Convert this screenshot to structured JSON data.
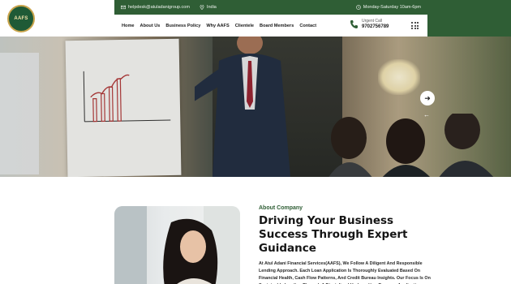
{
  "header": {
    "logo_text": "AAFS",
    "email": "helpdesk@atuladanigroup.com",
    "location": "India",
    "hours": "Monday-Saturday 10am-6pm",
    "nav": [
      "Home",
      "About Us",
      "Business Policy",
      "Why AAFS",
      "Clientele",
      "Board Members",
      "Contact"
    ],
    "call_label": "Urgent Call",
    "call_number": "9702756789",
    "colors": {
      "brand_green": "#2f5e35",
      "logo_gold": "#c9a44c"
    }
  },
  "hero": {
    "next_icon": "arrow-right-icon",
    "prev_icon": "arrow-left-icon"
  },
  "about": {
    "label": "About Company",
    "heading": "Driving Your Business Success Through Expert Guidance",
    "body": "At Atul Adani Financial Services(AAFS), We Follow A Diligent And Responsible Lending Approach. Each Loan Application Is Thoroughly Evaluated Based On Financial Health, Cash Flow Patterns, And Credit Bureau Insights. Our Focus Is On Sustainable Lending Through A Disciplined Underwriting Process. Applications With Limited Financial Visibility Or"
  }
}
